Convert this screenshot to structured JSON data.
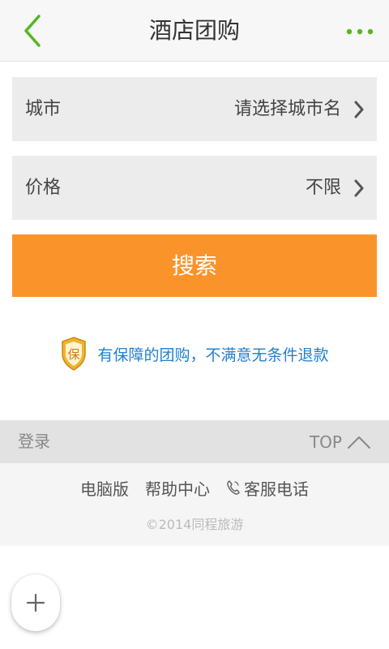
{
  "header": {
    "title": "酒店团购",
    "back_icon": "chevron-left-icon",
    "more_icon": "more-dots-icon",
    "accent_color": "#56b623"
  },
  "form": {
    "city": {
      "label": "城市",
      "value": "请选择城市名"
    },
    "price": {
      "label": "价格",
      "value": "不限"
    }
  },
  "search_button": {
    "label": "搜索",
    "color": "#fb932b"
  },
  "guarantee": {
    "badge_icon": "shield-badge-icon",
    "badge_char": "保",
    "text": "有保障的团购，不满意无条件退款",
    "text_color": "#1f7fd1"
  },
  "footer_bar": {
    "login": "登录",
    "top": "TOP"
  },
  "footer": {
    "links": [
      "电脑版",
      "帮助中心",
      "客服电话"
    ],
    "copyright": "©2014同程旅游"
  },
  "fab": {
    "icon": "plus-icon"
  }
}
